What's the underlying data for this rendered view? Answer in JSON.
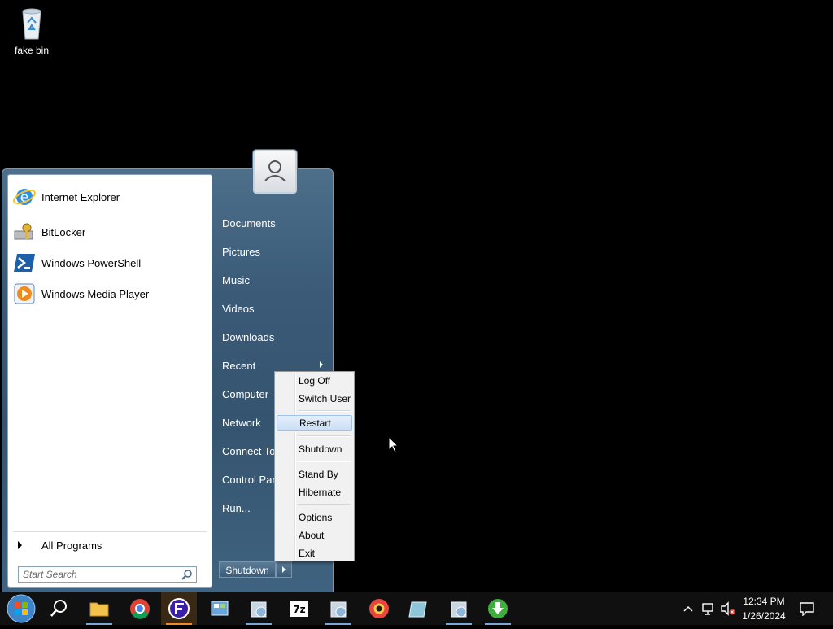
{
  "desktop": {
    "icons": [
      {
        "label": "fake bin",
        "icon": "recycle-bin-icon"
      }
    ]
  },
  "start_menu": {
    "programs": [
      {
        "label": "Internet Explorer",
        "icon": "internet-explorer-icon"
      },
      {
        "label": "BitLocker",
        "icon": "bitlocker-icon"
      },
      {
        "label": "Windows PowerShell",
        "icon": "powershell-icon"
      },
      {
        "label": "Windows Media Player",
        "icon": "media-player-icon"
      }
    ],
    "all_programs": "All Programs",
    "search_placeholder": "Start Search",
    "right_items": [
      "Documents",
      "Pictures",
      "Music",
      "Videos",
      "Downloads",
      "Recent",
      "Computer",
      "Network",
      "Connect To",
      "Control Panel",
      "Run..."
    ],
    "shutdown_label": "Shutdown"
  },
  "shutdown_menu": {
    "items": [
      "Log Off",
      "Switch User",
      "Restart",
      "Shutdown",
      "Stand By",
      "Hibernate",
      "Options",
      "About",
      "Exit"
    ],
    "highlighted": "Restart"
  },
  "taskbar": {
    "apps": [
      "start-orb-icon",
      "search-icon",
      "file-explorer-icon",
      "chrome-icon",
      "app-f-icon",
      "control-panel-icon",
      "installer-icon",
      "7zip-icon",
      "installer-icon",
      "chromium-icon",
      "tablet-icon",
      "installer-icon",
      "download-icon"
    ],
    "time": "12:34 PM",
    "date": "1/26/2024"
  },
  "colors": {
    "accent": "#3a5a78",
    "highlight": "#c9def5"
  }
}
